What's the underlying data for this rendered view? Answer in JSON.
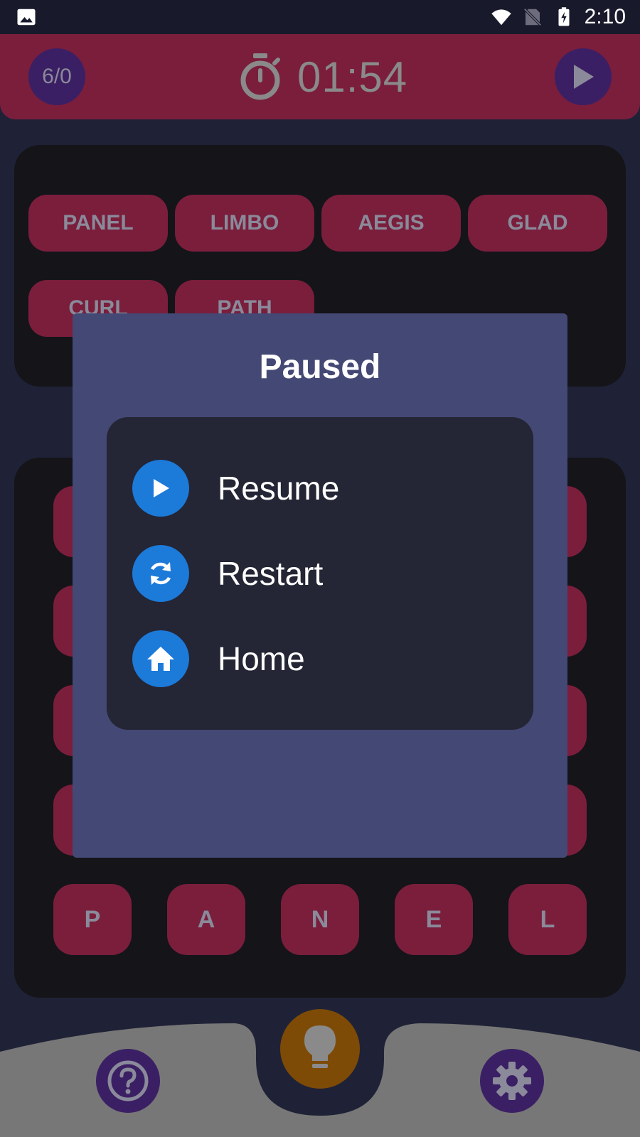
{
  "status_bar": {
    "time": "2:10",
    "icons": [
      "image-icon",
      "wifi-icon",
      "no-sim-icon",
      "battery-charging-icon"
    ]
  },
  "top_bar": {
    "score": "6/0",
    "timer": "01:54",
    "timer_icon": "stopwatch-icon",
    "play_icon": "play-icon"
  },
  "found_words": [
    "PANEL",
    "LIMBO",
    "AEGIS",
    "GLAD",
    "CURL",
    "PATH"
  ],
  "letter_row": [
    "P",
    "A",
    "N",
    "E",
    "L"
  ],
  "pause_dialog": {
    "title": "Paused",
    "items": [
      {
        "label": "Resume",
        "icon": "play-icon"
      },
      {
        "label": "Restart",
        "icon": "refresh-icon"
      },
      {
        "label": "Home",
        "icon": "home-icon"
      }
    ]
  },
  "bottom_bar": {
    "help_icon": "help-icon",
    "hint_icon": "lightbulb-icon",
    "settings_icon": "gear-icon"
  },
  "colors": {
    "background": "#1f2236",
    "accent_tile": "#7a1e3c",
    "dialog": "#444874",
    "menu_icon": "#1c7ad9",
    "hint": "#7e4b06"
  }
}
